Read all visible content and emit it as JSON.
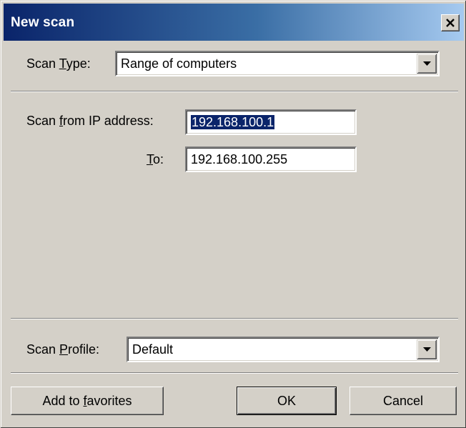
{
  "window": {
    "title": "New scan"
  },
  "scan_type": {
    "label_pre": "Scan ",
    "label_key": "T",
    "label_post": "ype:",
    "value": "Range of computers"
  },
  "range": {
    "from_label_pre": "Scan ",
    "from_label_key": "f",
    "from_label_post": "rom IP address:",
    "from_value": "192.168.100.1",
    "to_label_key": "T",
    "to_label_post": "o:",
    "to_value": "192.168.100.255"
  },
  "scan_profile": {
    "label_pre": "Scan ",
    "label_key": "P",
    "label_post": "rofile:",
    "value": "Default"
  },
  "buttons": {
    "favorites_pre": "Add to ",
    "favorites_key": "f",
    "favorites_post": "avorites",
    "ok": "OK",
    "cancel": "Cancel"
  },
  "icons": {
    "close": "close-icon",
    "dropdown": "chevron-down-icon"
  },
  "colors": {
    "titlebar_start": "#0a246a",
    "titlebar_end": "#a6caf0",
    "dialog_bg": "#d4d0c8",
    "selection": "#0a246a"
  }
}
